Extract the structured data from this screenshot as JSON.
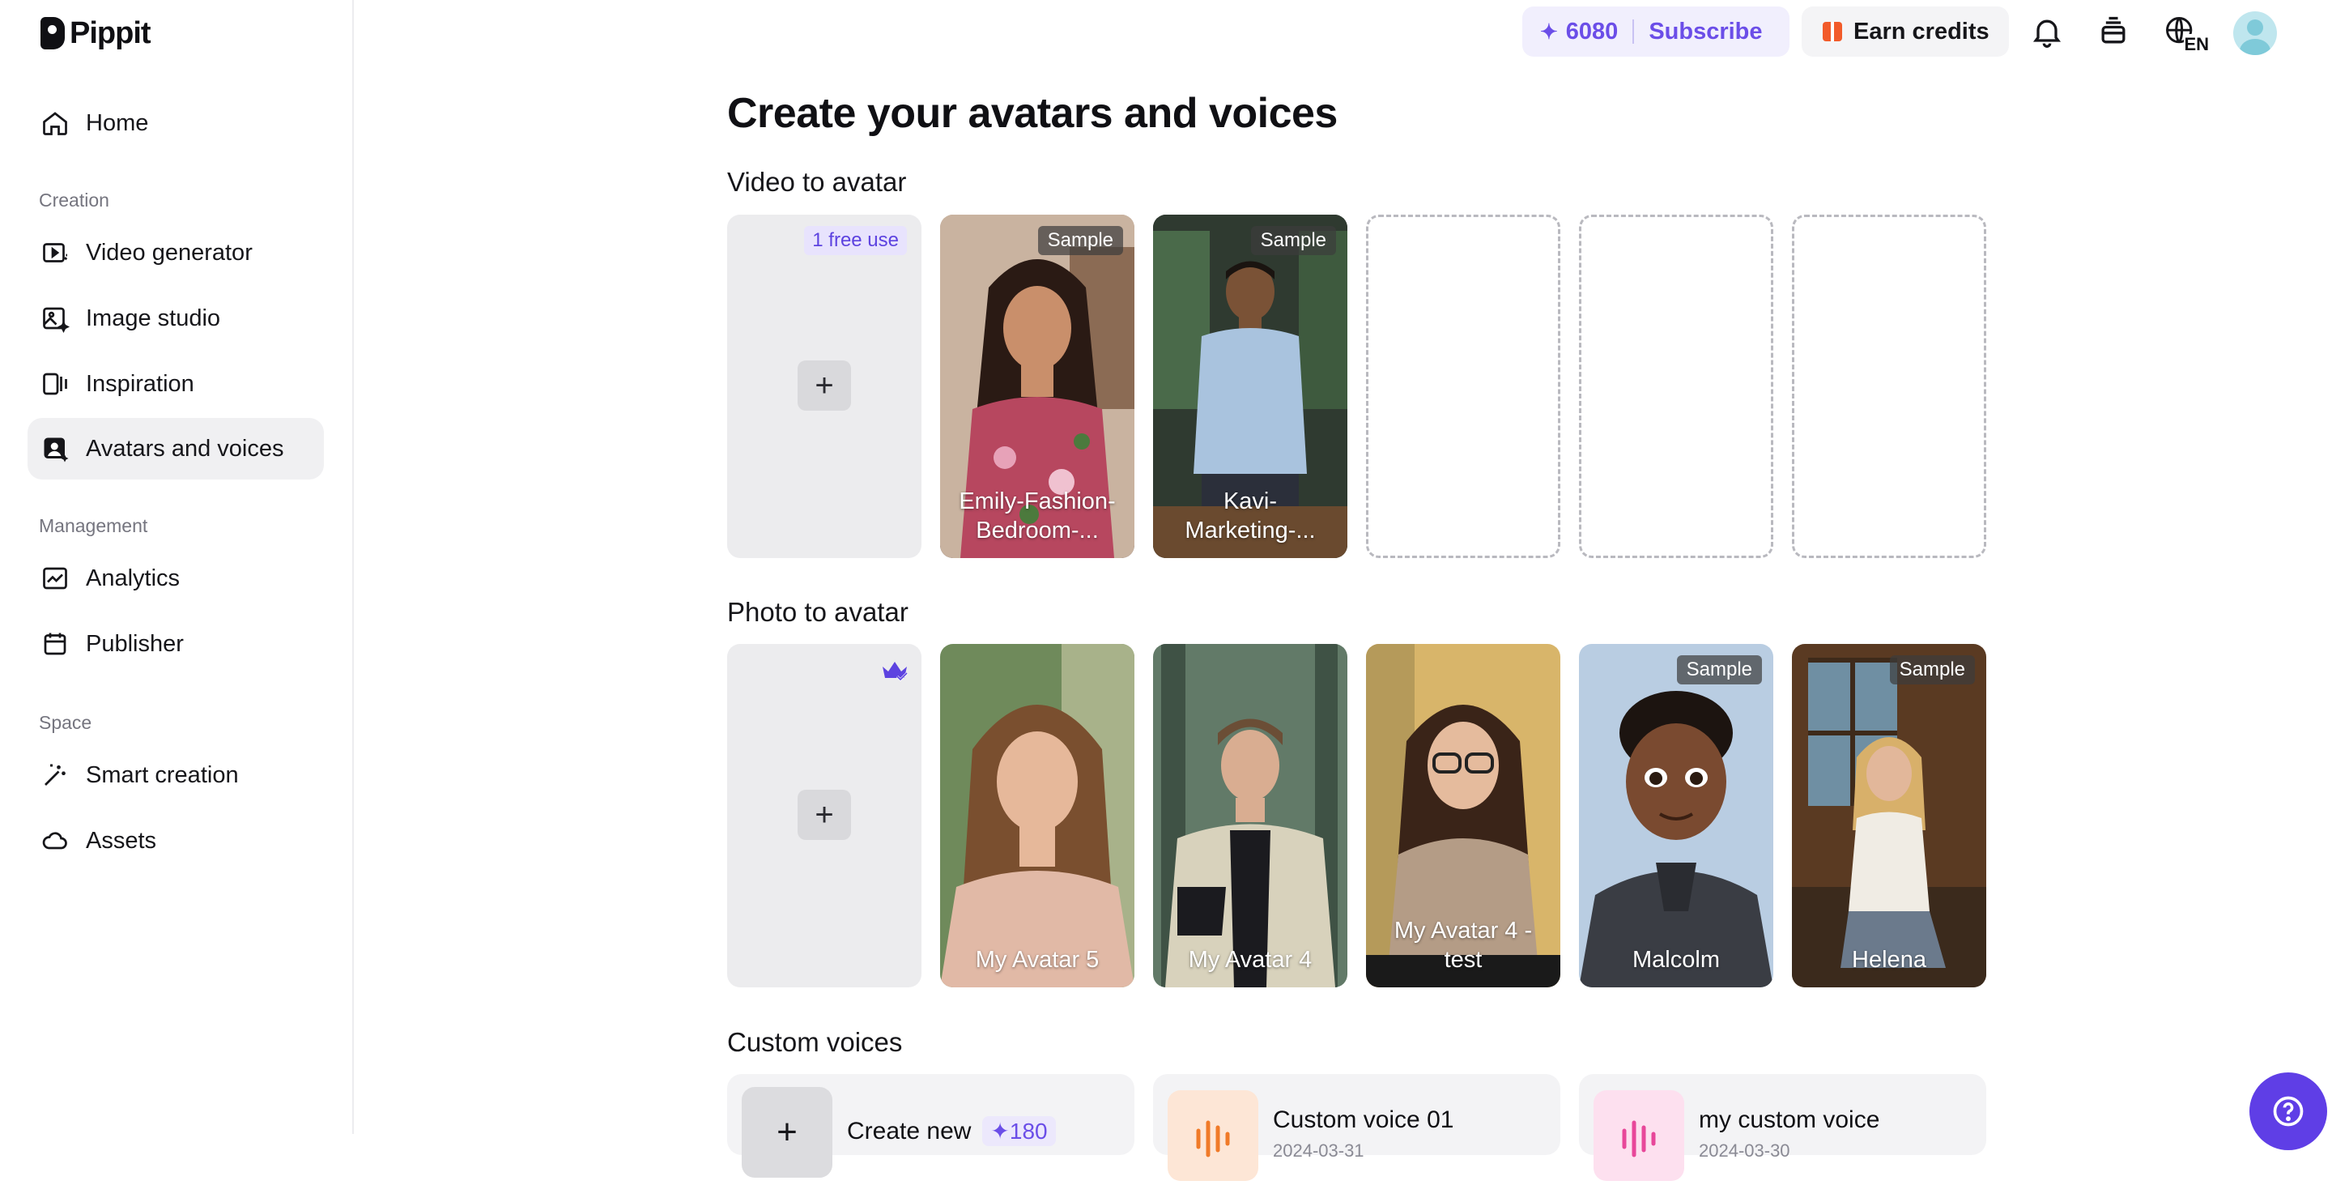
{
  "app": {
    "name": "Pippit"
  },
  "sidebar": {
    "home": "Home",
    "sections": {
      "creation": "Creation",
      "management": "Management",
      "space": "Space"
    },
    "creation_items": [
      {
        "label": "Video generator",
        "icon": "video-generator-icon"
      },
      {
        "label": "Image studio",
        "icon": "image-studio-icon"
      },
      {
        "label": "Inspiration",
        "icon": "inspiration-icon"
      },
      {
        "label": "Avatars and voices",
        "icon": "avatars-icon",
        "active": true
      }
    ],
    "management_items": [
      {
        "label": "Analytics",
        "icon": "analytics-icon"
      },
      {
        "label": "Publisher",
        "icon": "calendar-icon"
      }
    ],
    "space_items": [
      {
        "label": "Smart creation",
        "icon": "magic-wand-icon"
      },
      {
        "label": "Assets",
        "icon": "cloud-icon"
      }
    ]
  },
  "topbar": {
    "credits": "6080",
    "subscribe": "Subscribe",
    "earn_credits": "Earn credits",
    "language": "EN"
  },
  "main": {
    "title": "Create your avatars and voices",
    "video_to_avatar": {
      "heading": "Video to avatar",
      "free_badge": "1 free use",
      "cards": [
        {
          "label": "Emily-Fashion-Bedroom-...",
          "badge": "Sample"
        },
        {
          "label": "Kavi-Marketing-...",
          "badge": "Sample"
        }
      ]
    },
    "photo_to_avatar": {
      "heading": "Photo to avatar",
      "cards": [
        {
          "label": "My Avatar 5",
          "badge": ""
        },
        {
          "label": "My Avatar 4",
          "badge": ""
        },
        {
          "label": "My Avatar 4 - test",
          "badge": ""
        },
        {
          "label": "Malcolm",
          "badge": "Sample"
        },
        {
          "label": "Helena",
          "badge": "Sample"
        }
      ]
    },
    "custom_voices": {
      "heading": "Custom voices",
      "create_new": "Create new",
      "create_cost": "180",
      "voices": [
        {
          "title": "Custom voice 01",
          "date": "2024-03-31"
        },
        {
          "title": "my custom voice",
          "date": "2024-03-30"
        }
      ]
    }
  },
  "colors": {
    "accent": "#6b4ee8",
    "help_button": "#5f3ee6"
  }
}
